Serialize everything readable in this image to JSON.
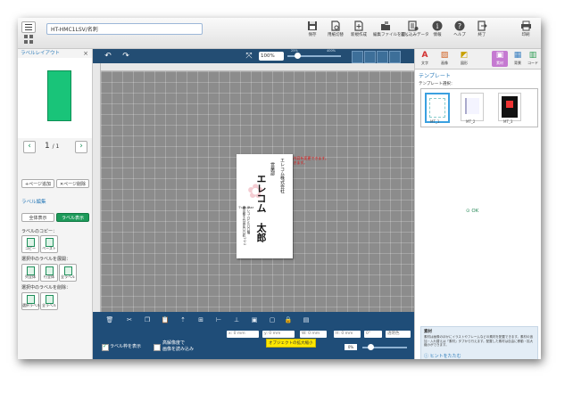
{
  "app": {
    "file_tab": "HT-HMC1LSV/名刺"
  },
  "toolbar": [
    {
      "label": "保存",
      "icon": "save-icon"
    },
    {
      "label": "用紙切替",
      "icon": "paper-switch-icon"
    },
    {
      "label": "新規作成",
      "icon": "new-file-icon"
    },
    {
      "label": "編集ファイルを開く",
      "icon": "open-file-icon"
    },
    {
      "label": "差し込みデータ",
      "icon": "merge-data-icon"
    },
    {
      "label": "情報",
      "icon": "info-icon"
    },
    {
      "label": "ヘルプ",
      "icon": "help-icon"
    },
    {
      "label": "終了",
      "icon": "exit-icon"
    },
    {
      "label": "印刷",
      "icon": "print-icon"
    }
  ],
  "left_panel": {
    "title": "ラベルレイアウト",
    "page_current": "1",
    "page_total": "/ 1",
    "add_page": "+ページ追加",
    "delete_page": "✕ページ削除",
    "label_edit_title": "ラベル編集",
    "show_all": "全体表示",
    "show_label": "ラベル表示",
    "copy_title": "ラベルのコピー：",
    "copy": "コピー",
    "paste": "ペースト",
    "expand_title": "選択中のラベルを展開：",
    "expand_items": [
      "列全体",
      "行全体",
      "全ラベル"
    ],
    "delete_title": "選択中のラベルを削除：",
    "delete_items": [
      "選択ラベル",
      "全ラベル"
    ]
  },
  "canvas": {
    "zoom": "100%",
    "zoom_min": "25%",
    "zoom_max": "400%",
    "warning_line1": "※「編集」から名刺の実際の表示内容を変更できます。",
    "warning_line2": "※文字をクリックすると編集ができます。",
    "card": {
      "company": "エレコム株式会社",
      "department": "営業部",
      "name": "エレコム　太郎",
      "postal": "〒123-4567",
      "address1": "東京都千代田区〇〇町1-2-3",
      "address2": "エレコムビル〇〇階"
    }
  },
  "bottom_bar": {
    "x_field": "x: 0 mm",
    "y_field": "y: 0 mm",
    "w_field": "W: 0 mm",
    "h_field": "H: 0 mm",
    "rotation": "0°",
    "opacity_label": "透明色",
    "show_frame_label": "ラベル枠を表示",
    "hires_label1": "高解像度で",
    "hires_label2": "画像を読み込み",
    "opacity_value": "0%",
    "tooltip": "オブジェクトの拡大縮小"
  },
  "right_panel": {
    "tabs": [
      {
        "glyph": "A",
        "label": "文字"
      },
      {
        "glyph": "▨",
        "label": "画像"
      },
      {
        "glyph": "◩",
        "label": "図形"
      },
      {
        "glyph": "▣",
        "label": "素材"
      },
      {
        "glyph": "▦",
        "label": "背景"
      },
      {
        "glyph": "▥",
        "label": "コード"
      }
    ],
    "title": "テンプレート",
    "subtitle": "テンプレート選択：",
    "templates": [
      "MT_1",
      "MT_2",
      "MT_3"
    ],
    "ok": "OK",
    "hint_title": "素材",
    "hint_body": "素材は画像のほかにイラストやフレームなどの素材を配置できます。素材の追加・入れ替えは「素材」タブから行えます。配置した素材は自由に移動・拡大縮小ができます。",
    "hint_close": "ヒントをたたむ"
  },
  "colors": {
    "accent": "#1d9a5a",
    "nav": "#234d73",
    "thumb": "#19c479"
  }
}
